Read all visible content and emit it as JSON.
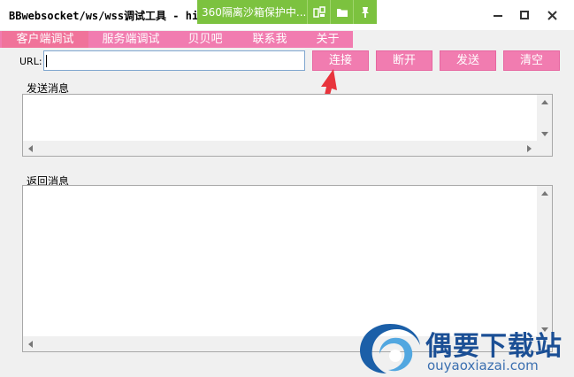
{
  "window": {
    "title": "BBwebsocket/ws/wss调试工具 - hi",
    "minimize_icon": "minimize-icon",
    "maximize_icon": "maximize-icon",
    "close_icon": "close-icon"
  },
  "sandbox_bar": {
    "text": "360隔离沙箱保护中...",
    "icons": [
      "sandbox-app-icon",
      "folder-icon",
      "pin-icon"
    ],
    "color": "#7cc23f"
  },
  "tabs": [
    {
      "label": "客户端调试",
      "active": true
    },
    {
      "label": "服务端调试",
      "active": false
    },
    {
      "label": "贝贝吧",
      "active": false
    },
    {
      "label": "联系我",
      "active": false
    },
    {
      "label": "关于",
      "active": false
    }
  ],
  "url": {
    "label": "URL:",
    "value": ""
  },
  "buttons": {
    "connect": "连接",
    "disconnect": "断开",
    "send": "发送",
    "clear": "清空"
  },
  "send_section": {
    "label": "发送消息",
    "content": ""
  },
  "return_section": {
    "label": "返回消息",
    "content": ""
  },
  "watermark": {
    "name": "偶要下载站",
    "url": "ouyaoxiazai.com"
  },
  "colors": {
    "accent_pink": "#f17cb0",
    "active_tab": "#f0739a",
    "arrow_red": "#e8343c"
  }
}
